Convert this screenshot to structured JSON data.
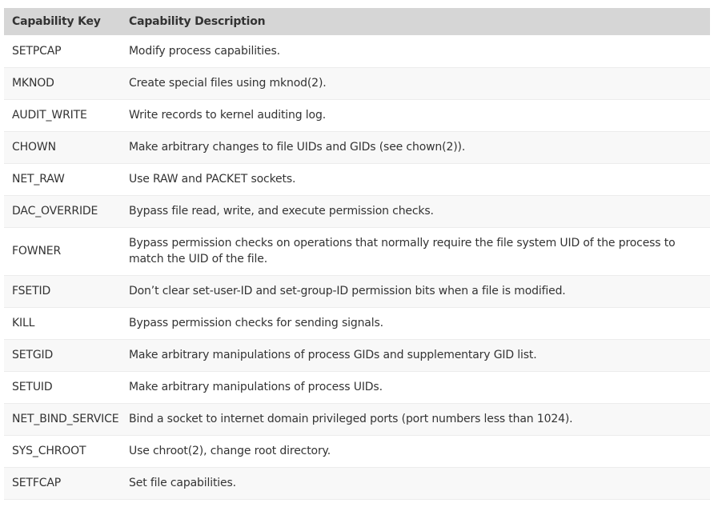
{
  "table": {
    "headers": {
      "key": "Capability Key",
      "description": "Capability Description"
    },
    "rows": [
      {
        "key": "SETPCAP",
        "description": "Modify process capabilities."
      },
      {
        "key": "MKNOD",
        "description": "Create special files using mknod(2)."
      },
      {
        "key": "AUDIT_WRITE",
        "description": "Write records to kernel auditing log."
      },
      {
        "key": "CHOWN",
        "description": "Make arbitrary changes to file UIDs and GIDs (see chown(2))."
      },
      {
        "key": "NET_RAW",
        "description": "Use RAW and PACKET sockets."
      },
      {
        "key": "DAC_OVERRIDE",
        "description": "Bypass file read, write, and execute permission checks."
      },
      {
        "key": "FOWNER",
        "description": "Bypass permission checks on operations that normally require the file system UID of the process to match the UID of the file."
      },
      {
        "key": "FSETID",
        "description": "Don’t clear set-user-ID and set-group-ID permission bits when a file is modified."
      },
      {
        "key": "KILL",
        "description": "Bypass permission checks for sending signals."
      },
      {
        "key": "SETGID",
        "description": "Make arbitrary manipulations of process GIDs and supplementary GID list."
      },
      {
        "key": "SETUID",
        "description": "Make arbitrary manipulations of process UIDs."
      },
      {
        "key": "NET_BIND_SERVICE",
        "description": "Bind a socket to internet domain privileged ports (port numbers less than 1024)."
      },
      {
        "key": "SYS_CHROOT",
        "description": "Use chroot(2), change root directory."
      },
      {
        "key": "SETFCAP",
        "description": "Set file capabilities."
      }
    ]
  }
}
